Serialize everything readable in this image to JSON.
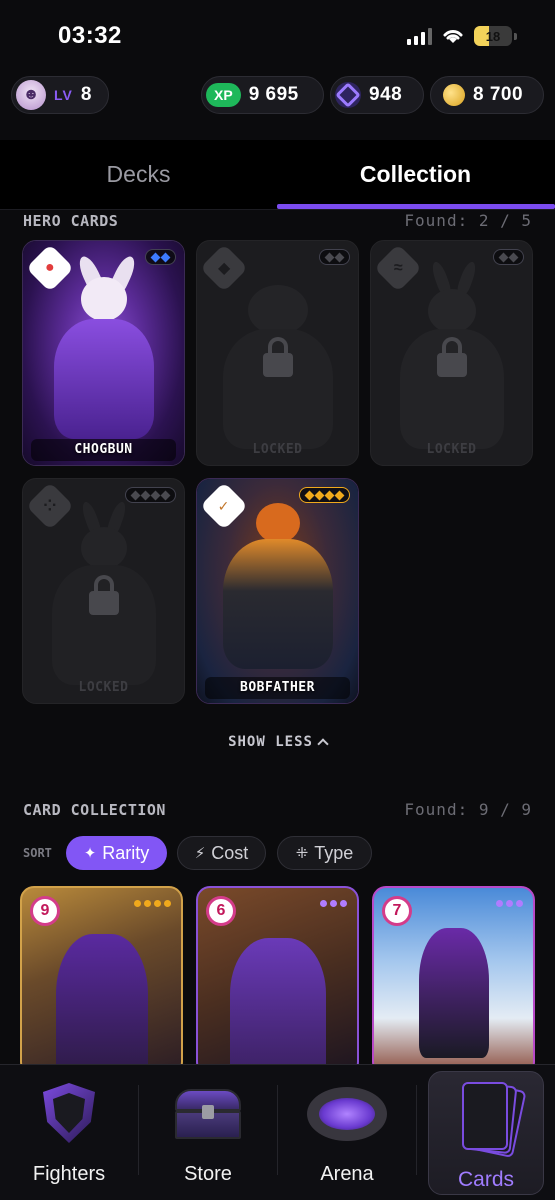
{
  "status_bar": {
    "time": "03:32",
    "battery_level": "18"
  },
  "hud": {
    "level_tag": "LV",
    "level": "8",
    "xp_tag": "XP",
    "xp": "9 695",
    "gems": "948",
    "coins": "8 700"
  },
  "tabs": [
    {
      "label": "Decks",
      "active": false
    },
    {
      "label": "Collection",
      "active": true
    }
  ],
  "hero_section": {
    "title": "HERO CARDS",
    "found": "Found: 2 / 5",
    "cards": [
      {
        "name": "CHOGBUN",
        "locked": false,
        "rarity": "blue",
        "rarity_count": 2,
        "element_icon": "drop-icon"
      },
      {
        "name": "LOCKED",
        "locked": true,
        "rarity": "grey",
        "rarity_count": 2,
        "element_icon": "diamond-icon"
      },
      {
        "name": "LOCKED",
        "locked": true,
        "rarity": "grey",
        "rarity_count": 2,
        "element_icon": "wave-icon"
      },
      {
        "name": "LOCKED",
        "locked": true,
        "rarity": "grey",
        "rarity_count": 4,
        "element_icon": "dice-icon"
      },
      {
        "name": "BOBFATHER",
        "locked": false,
        "rarity": "gold",
        "rarity_count": 4,
        "element_icon": "chart-icon"
      }
    ],
    "toggle_label": "SHOW LESS"
  },
  "collection_section": {
    "title": "CARD COLLECTION",
    "found": "Found: 9 / 9",
    "sort_label": "SORT",
    "sort_options": [
      {
        "label": "Rarity",
        "icon": "sparkle-icon",
        "active": true
      },
      {
        "label": "Cost",
        "icon": "lightning-icon",
        "active": false
      },
      {
        "label": "Type",
        "icon": "grid-dots-icon",
        "active": false
      }
    ],
    "cards": [
      {
        "cost": "9",
        "pips": "gold"
      },
      {
        "cost": "6",
        "pips": "purple"
      },
      {
        "cost": "7",
        "pips": "purple"
      }
    ]
  },
  "bottom_nav": [
    {
      "label": "Fighters",
      "icon": "shield-icon",
      "active": false
    },
    {
      "label": "Store",
      "icon": "chest-icon",
      "active": false
    },
    {
      "label": "Arena",
      "icon": "arena-icon",
      "active": false
    },
    {
      "label": "Cards",
      "icon": "cards-icon",
      "active": true
    }
  ],
  "colors": {
    "accent": "#8256f5",
    "xp_green": "#1eb85a",
    "gold": "#f0a91c",
    "background": "#0b0b0d"
  }
}
